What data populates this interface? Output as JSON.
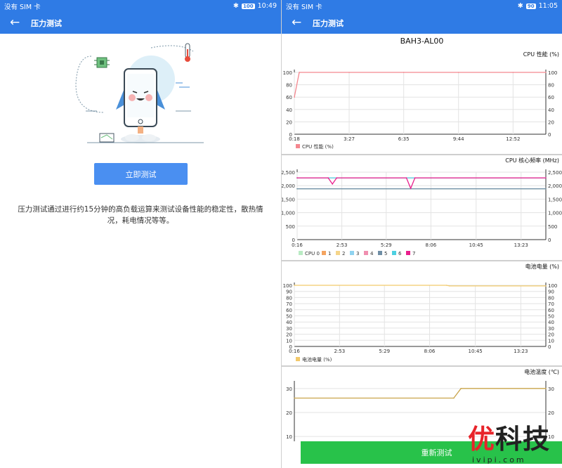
{
  "left": {
    "status": {
      "carrier": "没有 SIM 卡",
      "battery": "100",
      "time": "10:49"
    },
    "appbar": {
      "title": "压力测试"
    },
    "start_button": "立即测试",
    "description": "压力测试通过进行约15分钟的高负载运算来测试设备性能的稳定性，散热情况，耗电情况等等。"
  },
  "right": {
    "status": {
      "carrier": "没有 SIM 卡",
      "battery": "90",
      "time": "11:05"
    },
    "appbar": {
      "title": "压力测试"
    },
    "device_name": "BAH3-AL00",
    "retest_button": "重新测试"
  },
  "watermark": {
    "brand_red": "优",
    "brand_black": "科技",
    "site": "ivipi.com"
  },
  "colors": {
    "primary": "#2f7be5",
    "button_blue": "#4a8ff1",
    "button_green": "#28c24a",
    "watermark_red": "#e8242a"
  },
  "chart_data": [
    {
      "type": "line",
      "title": "CPU 性能 (%)",
      "x_ticks": [
        "0:18",
        "3:27",
        "6:35",
        "9:44",
        "12:52"
      ],
      "y_ticks": [
        "0",
        "20",
        "40",
        "60",
        "80",
        "100"
      ],
      "ylim": [
        0,
        100
      ],
      "series": [
        {
          "name": "CPU 性能 (%)",
          "color": "#f4878f",
          "points": [
            [
              "0:18",
              60
            ],
            [
              "0:35",
              100
            ],
            [
              "3:27",
              100
            ],
            [
              "6:35",
              100
            ],
            [
              "9:44",
              100
            ],
            [
              "12:52",
              100
            ],
            [
              "14:45",
              100
            ]
          ]
        }
      ],
      "legend": "bottom-left"
    },
    {
      "type": "line",
      "title": "CPU 核心频率 (MHz)",
      "x_ticks": [
        "0:16",
        "2:53",
        "5:29",
        "8:06",
        "10:45",
        "13:23"
      ],
      "y_ticks": [
        "0",
        "500",
        "1,000",
        "1,500",
        "2,000",
        "2,500"
      ],
      "ylim": [
        0,
        2500
      ],
      "legend_prefix": "CPU",
      "series": [
        {
          "name": "0",
          "color": "#b9ebc3",
          "points": [
            [
              "0:16",
              1885
            ],
            [
              "14:50",
              1885
            ]
          ]
        },
        {
          "name": "1",
          "color": "#f4a460",
          "points": [
            [
              "0:16",
              1885
            ],
            [
              "14:50",
              1885
            ]
          ]
        },
        {
          "name": "2",
          "color": "#f5d58a",
          "points": [
            [
              "0:16",
              1885
            ],
            [
              "14:50",
              1885
            ]
          ]
        },
        {
          "name": "3",
          "color": "#8fd3f0",
          "points": [
            [
              "0:16",
              1885
            ],
            [
              "14:50",
              1885
            ]
          ]
        },
        {
          "name": "4",
          "color": "#f08fb0",
          "points": [
            [
              "0:16",
              2290
            ],
            [
              "14:50",
              2290
            ]
          ]
        },
        {
          "name": "5",
          "color": "#6f8ea5",
          "points": [
            [
              "0:16",
              1885
            ],
            [
              "14:50",
              1885
            ]
          ]
        },
        {
          "name": "6",
          "color": "#4dd0e1",
          "points": [
            [
              "0:16",
              2290
            ],
            [
              "14:50",
              2290
            ]
          ]
        },
        {
          "name": "7",
          "color": "#e91e8c",
          "points": [
            [
              "0:16",
              2290
            ],
            [
              "2:05",
              2290
            ],
            [
              "2:20",
              2060
            ],
            [
              "2:35",
              2290
            ],
            [
              "6:40",
              2290
            ],
            [
              "6:55",
              1900
            ],
            [
              "7:10",
              2290
            ],
            [
              "14:50",
              2290
            ]
          ]
        }
      ],
      "legend": "bottom-left"
    },
    {
      "type": "line",
      "title": "电池电量 (%)",
      "x_ticks": [
        "0:16",
        "2:53",
        "5:29",
        "8:06",
        "10:45",
        "13:23"
      ],
      "y_ticks": [
        "0",
        "10",
        "20",
        "30",
        "40",
        "50",
        "60",
        "70",
        "80",
        "90",
        "100"
      ],
      "ylim": [
        0,
        100
      ],
      "series": [
        {
          "name": "电池电量 (%)",
          "color": "#f2c96b",
          "points": [
            [
              "0:16",
              100
            ],
            [
              "9:05",
              100
            ],
            [
              "9:15",
              99
            ],
            [
              "14:50",
              99
            ]
          ]
        }
      ],
      "legend": "bottom-left"
    },
    {
      "type": "line",
      "title": "电池温度 (℃)",
      "y_ticks": [
        "10",
        "20",
        "30"
      ],
      "series": [
        {
          "name": "电池温度",
          "color": "#c9a44a",
          "points": [
            [
              "0:16",
              26
            ],
            [
              "9:30",
              26
            ],
            [
              "9:55",
              30
            ],
            [
              "14:50",
              30
            ]
          ]
        }
      ]
    }
  ]
}
